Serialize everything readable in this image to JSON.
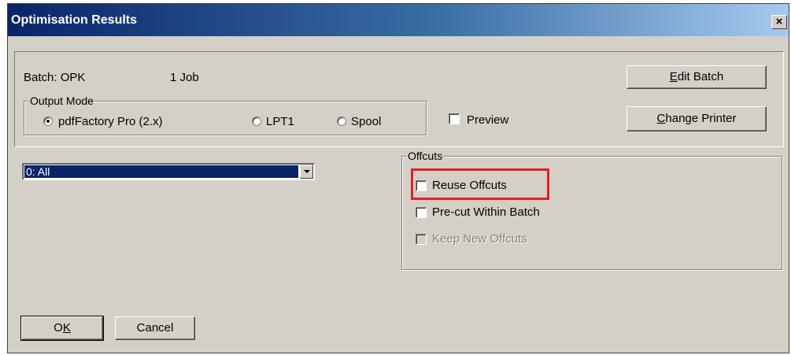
{
  "window": {
    "title": "Optimisation Results",
    "close_glyph": "×"
  },
  "batch": {
    "label": "Batch: OPK",
    "jobs": "1 Job"
  },
  "output_mode": {
    "legend": "Output Mode",
    "options": [
      {
        "label": "pdfFactory Pro (2.x)",
        "selected": true
      },
      {
        "label": "LPT1",
        "selected": false
      },
      {
        "label": "Spool",
        "selected": false
      }
    ]
  },
  "preview": {
    "label": "Preview",
    "checked": false
  },
  "buttons": {
    "edit_batch": {
      "accel": "E",
      "rest": "dit Batch"
    },
    "change_printer": {
      "accel": "C",
      "rest": "hange Printer"
    },
    "ok": {
      "pre": "O",
      "accel": "K"
    },
    "cancel": "Cancel"
  },
  "filter_select": {
    "value": "0: All"
  },
  "offcuts": {
    "legend": "Offcuts",
    "reuse": {
      "label": "Reuse Offcuts",
      "checked": false
    },
    "precut": {
      "label": "Pre-cut Within Batch",
      "checked": false
    },
    "keep_new": {
      "label": "Keep New Offcuts",
      "checked": false,
      "disabled": true
    }
  },
  "colors": {
    "highlight": "#e31e24",
    "title_bar": "#0a246a",
    "selection": "#0a246a"
  }
}
